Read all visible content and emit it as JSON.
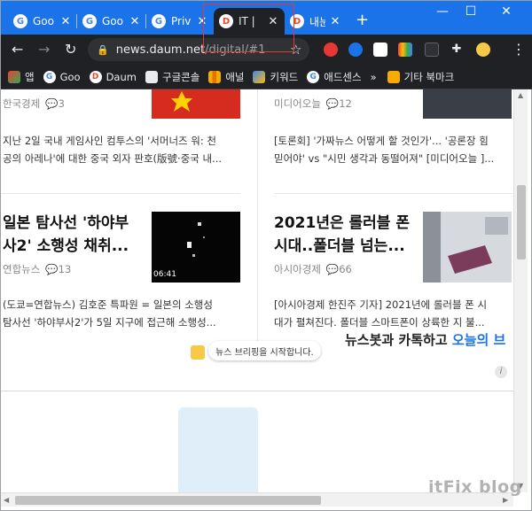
{
  "browser": {
    "tabs": [
      {
        "favicon": "google-g-icon",
        "title": "Goo",
        "close": "✕"
      },
      {
        "favicon": "google-g-icon",
        "title": "Goo",
        "close": "✕"
      },
      {
        "favicon": "google-g-icon",
        "title": "Priv",
        "close": "✕"
      },
      {
        "favicon": "daum-d-icon",
        "title": "IT |",
        "close": "✕"
      },
      {
        "favicon": "daum-d-icon",
        "title": "내눈",
        "close": "✕"
      }
    ],
    "new_tab": "+",
    "window_controls": {
      "minimize": "—",
      "maximize": "☐",
      "close": "✕"
    }
  },
  "toolbar": {
    "back": "←",
    "forward": "→",
    "reload": "↻",
    "url_host": "news.daum.net",
    "url_path": "/digital/#1",
    "bookmark_star": "☆",
    "extensions_icon": "puzzle-icon",
    "menu": "⋮"
  },
  "bookmarks": {
    "apps_label": "앱",
    "items": [
      {
        "icon": "google-g-icon",
        "label": "Goo"
      },
      {
        "icon": "daum-d-icon",
        "label": "Daum"
      },
      {
        "icon": "store-icon",
        "label": "구글콘솔"
      },
      {
        "icon": "bar-chart-icon",
        "label": "애널"
      },
      {
        "icon": "ads-icon",
        "label": "키워드"
      },
      {
        "icon": "google-g-icon",
        "label": "애드센스"
      }
    ],
    "overflow": "»",
    "other_folder": "기타 북마크"
  },
  "articles": {
    "top_left": {
      "source": "한국경제",
      "comments": "3"
    },
    "top_right": {
      "source": "미디어오늘",
      "comments": "12"
    },
    "summary_left": [
      "지난 2일 국내 게임사인 컴투스의 '서머너즈 워: 천",
      "공의 아레나'에 대한 중국 외자 판호(版號·중국 내..."
    ],
    "summary_right": [
      "[토론회] '가짜뉴스 어떻게 할 것인가'... '공론장 힘",
      "믿어야' vs \"시민 생각과 동떨어져\" [미디어오늘 ]..."
    ],
    "mid_left": {
      "headline": [
        "일본 탐사선 '하야부",
        "사2' 소행성 채취..."
      ],
      "source": "연합뉴스",
      "comments": "13",
      "thumb_time": "06:41",
      "summary": [
        "(도쿄=연합뉴스) 김호준 특파원 = 일본의 소행성",
        "탐사선 '하야부사2'가 5일 지구에 접근해 소행성..."
      ]
    },
    "mid_right": {
      "headline": [
        "2021년은 롤러블 폰",
        "시대..폴더블 넘는..."
      ],
      "source": "아시아경제",
      "comments": "66",
      "summary": [
        "[아시아경제 한진주 기자] 2021년에 롤러블 폰 시",
        "대가 펼쳐진다. 폴더블 스마트폰이 상륙한 지 불..."
      ]
    }
  },
  "newsbot": {
    "pill": "뉴스 브리핑을 시작합니다.",
    "headline_prefix": "뉴스봇과 카톡하고 ",
    "headline_link": "오늘의 브"
  },
  "info": "i",
  "watermark": "itFix blog",
  "colors": {
    "tabbar": "#1a73e8",
    "toolbar": "#202124",
    "highlight_box": "#e53935",
    "link": "#1a73e8"
  }
}
